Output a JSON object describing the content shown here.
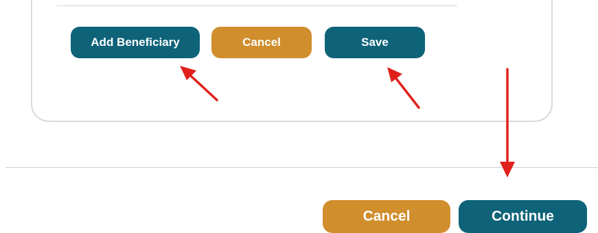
{
  "beneficiary_form": {
    "add_beneficiary_label": "Add Beneficiary",
    "cancel_label": "Cancel",
    "save_label": "Save"
  },
  "footer": {
    "cancel_label": "Cancel",
    "continue_label": "Continue"
  },
  "colors": {
    "primary_teal": "#0e6379",
    "secondary_gold": "#d08e2d",
    "annotation_arrow_red": "#e0201b"
  },
  "icons": [
    "arrow-pointer-icon"
  ]
}
